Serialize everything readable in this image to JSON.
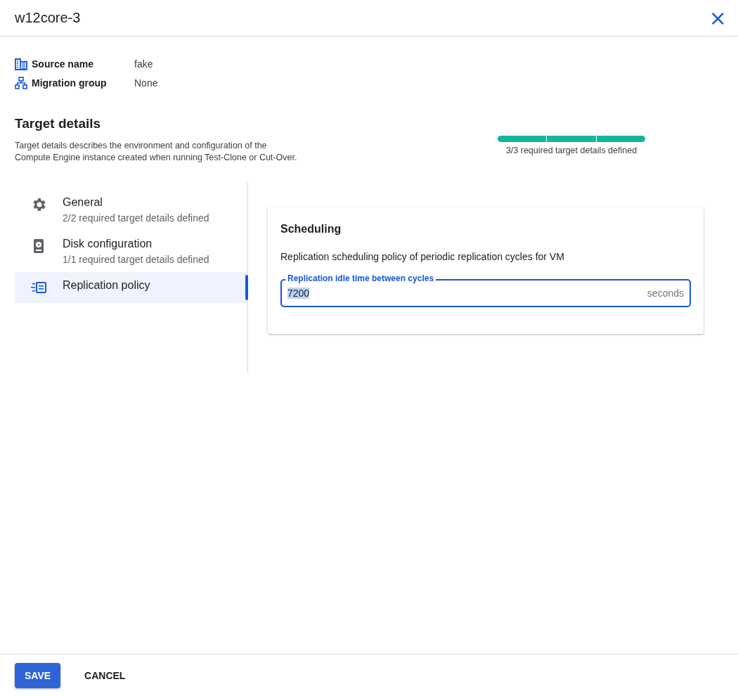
{
  "window": {
    "title": "w12core-3",
    "close_icon": "×"
  },
  "info": [
    {
      "kind": "source",
      "label": "Source name",
      "value": "fake"
    },
    {
      "kind": "group",
      "label": "Migration group",
      "value": "None"
    }
  ],
  "target_details": {
    "title": "Target details",
    "description": "Target details describes the environment and configuration of the Compute Engine instance created when running Test-Clone or Cut-Over.",
    "progress": {
      "segments": [
        {
          "filled": true
        },
        {
          "filled": true
        },
        {
          "filled": true
        }
      ],
      "caption": "3/3 required target details defined"
    }
  },
  "nav": [
    {
      "kind": "gear",
      "label": "General",
      "subtitle": "2/2 required target details defined",
      "selected": false
    },
    {
      "kind": "disk",
      "label": "Disk configuration",
      "subtitle": "1/1 required target details defined",
      "selected": false
    },
    {
      "kind": "replication",
      "label": "Replication policy",
      "selected": true
    }
  ],
  "card": {
    "title": "Scheduling",
    "description": "Replication scheduling policy of periodic replication cycles for VM",
    "field": {
      "label": "Replication idle time between cycles",
      "value": "7200",
      "suffix": "seconds"
    }
  },
  "buttons": [
    {
      "kind": "primary",
      "label": "SAVE"
    },
    {
      "kind": "text",
      "label": "CANCEL"
    }
  ]
}
